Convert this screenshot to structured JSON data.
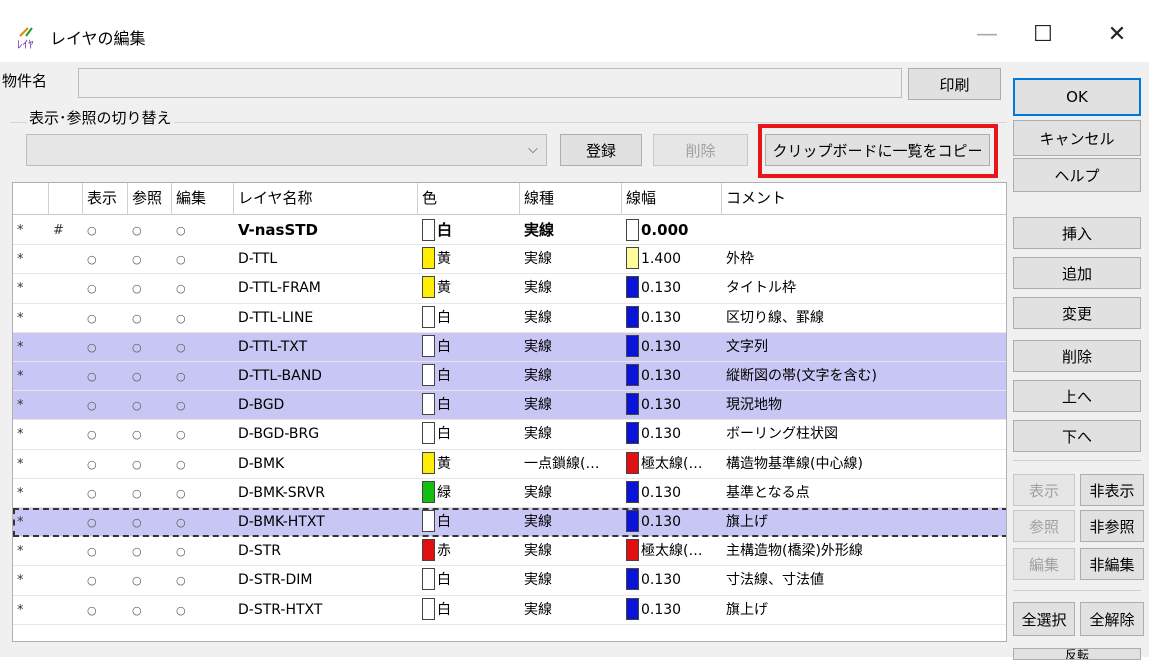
{
  "window": {
    "title": "レイヤの編集",
    "icon_text": "ﾚｲﾔ",
    "min_glyph": "—",
    "max_glyph": "☐",
    "close_glyph": "✕"
  },
  "property": {
    "label": "物件名",
    "value": "",
    "print_label": "印刷"
  },
  "toggle": {
    "group_label": "表示･参照の切り替え",
    "combo_value": "",
    "combo_arrow": "⌵",
    "register_label": "登録",
    "delete_label": "削除",
    "copy_label": "クリップボードに一覧をコピー"
  },
  "right_panel": {
    "ok": "OK",
    "cancel": "キャンセル",
    "help": "ヘルプ",
    "insert": "挿入",
    "add": "追加",
    "change": "変更",
    "delete": "削除",
    "up": "上へ",
    "down": "下へ",
    "show": "表示",
    "hide": "非表示",
    "ref": "参照",
    "unref": "非参照",
    "edit": "編集",
    "unedit": "非編集",
    "select_all": "全選択",
    "deselect_all": "全解除",
    "invert_partial": "反転"
  },
  "table": {
    "headers": [
      "",
      "",
      "表示",
      "参照",
      "編集",
      "レイヤ名称",
      "色",
      "線種",
      "線幅",
      "コメント"
    ],
    "rows": [
      {
        "star": "*",
        "hash": "#",
        "show": "○",
        "ref": "○",
        "edit": "○",
        "name": "V-nasSTD",
        "color_name": "白",
        "color": "#ffffff",
        "line": "実線",
        "width": "0.000",
        "width_color": "#ffffff",
        "comment": "",
        "bold": true,
        "selected": false
      },
      {
        "star": "*",
        "hash": "",
        "show": "○",
        "ref": "○",
        "edit": "○",
        "name": "D-TTL",
        "color_name": "黄",
        "color": "#ffee00",
        "line": "実線",
        "width": "1.400",
        "width_color": "#fffb9a",
        "comment": "外枠",
        "selected": false
      },
      {
        "star": "*",
        "hash": "",
        "show": "○",
        "ref": "○",
        "edit": "○",
        "name": "D-TTL-FRAM",
        "color_name": "黄",
        "color": "#ffee00",
        "line": "実線",
        "width": "0.130",
        "width_color": "#0a14d8",
        "comment": "タイトル枠",
        "selected": false
      },
      {
        "star": "*",
        "hash": "",
        "show": "○",
        "ref": "○",
        "edit": "○",
        "name": "D-TTL-LINE",
        "color_name": "白",
        "color": "#ffffff",
        "line": "実線",
        "width": "0.130",
        "width_color": "#0a14d8",
        "comment": "区切り線、罫線",
        "selected": false
      },
      {
        "star": "*",
        "hash": "",
        "show": "○",
        "ref": "○",
        "edit": "○",
        "name": "D-TTL-TXT",
        "color_name": "白",
        "color": "#ffffff",
        "line": "実線",
        "width": "0.130",
        "width_color": "#0a14d8",
        "comment": "文字列",
        "selected": true
      },
      {
        "star": "*",
        "hash": "",
        "show": "○",
        "ref": "○",
        "edit": "○",
        "name": "D-TTL-BAND",
        "color_name": "白",
        "color": "#ffffff",
        "line": "実線",
        "width": "0.130",
        "width_color": "#0a14d8",
        "comment": "縦断図の帯(文字を含む)",
        "selected": true
      },
      {
        "star": "*",
        "hash": "",
        "show": "○",
        "ref": "○",
        "edit": "○",
        "name": "D-BGD",
        "color_name": "白",
        "color": "#ffffff",
        "line": "実線",
        "width": "0.130",
        "width_color": "#0a14d8",
        "comment": "現況地物",
        "selected": true
      },
      {
        "star": "*",
        "hash": "",
        "show": "○",
        "ref": "○",
        "edit": "○",
        "name": "D-BGD-BRG",
        "color_name": "白",
        "color": "#ffffff",
        "line": "実線",
        "width": "0.130",
        "width_color": "#0a14d8",
        "comment": "ボーリング柱状図",
        "selected": false
      },
      {
        "star": "*",
        "hash": "",
        "show": "○",
        "ref": "○",
        "edit": "○",
        "name": "D-BMK",
        "color_name": "黄",
        "color": "#ffee00",
        "line": "一点鎖線(…",
        "width": "極太線(…",
        "width_color": "#e01010",
        "comment": "構造物基準線(中心線)",
        "selected": false
      },
      {
        "star": "*",
        "hash": "",
        "show": "○",
        "ref": "○",
        "edit": "○",
        "name": "D-BMK-SRVR",
        "color_name": "緑",
        "color": "#12c012",
        "line": "実線",
        "width": "0.130",
        "width_color": "#0a14d8",
        "comment": "基準となる点",
        "selected": false
      },
      {
        "star": "*",
        "hash": "",
        "show": "○",
        "ref": "○",
        "edit": "○",
        "name": "D-BMK-HTXT",
        "color_name": "白",
        "color": "#ffffff",
        "line": "実線",
        "width": "0.130",
        "width_color": "#0a14d8",
        "comment": "旗上げ",
        "selected": true,
        "focused": true
      },
      {
        "star": "*",
        "hash": "",
        "show": "○",
        "ref": "○",
        "edit": "○",
        "name": "D-STR",
        "color_name": "赤",
        "color": "#e01010",
        "line": "実線",
        "width": "極太線(…",
        "width_color": "#e01010",
        "comment": "主構造物(橋梁)外形線",
        "selected": false
      },
      {
        "star": "*",
        "hash": "",
        "show": "○",
        "ref": "○",
        "edit": "○",
        "name": "D-STR-DIM",
        "color_name": "白",
        "color": "#ffffff",
        "line": "実線",
        "width": "0.130",
        "width_color": "#0a14d8",
        "comment": "寸法線、寸法値",
        "selected": false
      },
      {
        "star": "*",
        "hash": "",
        "show": "○",
        "ref": "○",
        "edit": "○",
        "name": "D-STR-HTXT",
        "color_name": "白",
        "color": "#ffffff",
        "line": "実線",
        "width": "0.130",
        "width_color": "#0a14d8",
        "comment": "旗上げ",
        "selected": false
      }
    ]
  },
  "colors": {
    "selection": "#c7c6f5",
    "highlight_frame": "#e8161b",
    "default_button_border": "#0078d7"
  }
}
